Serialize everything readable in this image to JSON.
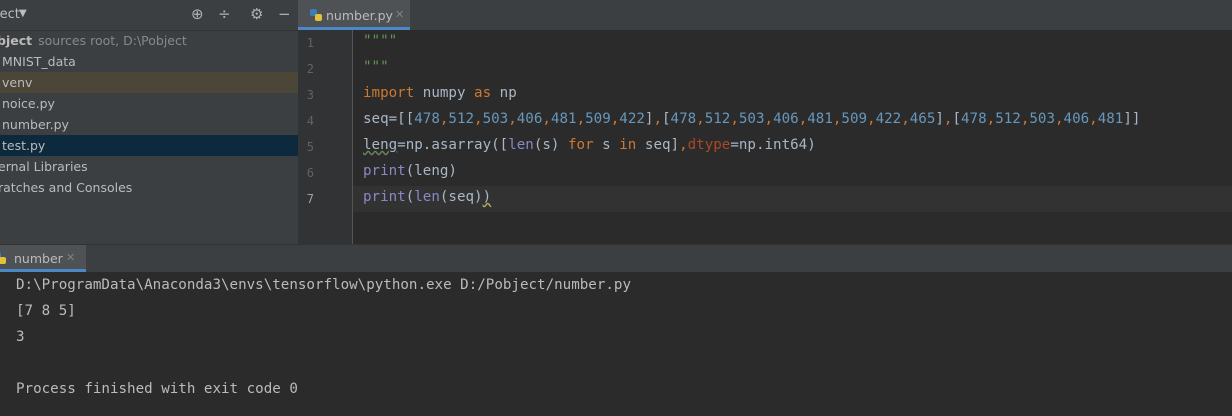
{
  "project_panel": {
    "toolbar_label": "ject",
    "tree": [
      {
        "label": "bject",
        "meta": "sources root,  D:\\Pobject"
      },
      {
        "label": "MNIST_data"
      },
      {
        "label": "venv"
      },
      {
        "label": "noice.py"
      },
      {
        "label": "number.py"
      },
      {
        "label": "test.py"
      },
      {
        "label": "ernal Libraries"
      },
      {
        "label": "ratches and Consoles"
      }
    ]
  },
  "editor": {
    "tab_label": "number.py",
    "line_numbers": [
      "1",
      "2",
      "3",
      "4",
      "5",
      "6",
      "7"
    ],
    "current_line": 7
  },
  "run_panel": {
    "tab_label": "number",
    "output": [
      "D:\\ProgramData\\Anaconda3\\envs\\tensorflow\\python.exe D:/Pobject/number.py",
      "[7 8 5]",
      "3",
      "",
      "Process finished with exit code 0"
    ]
  }
}
